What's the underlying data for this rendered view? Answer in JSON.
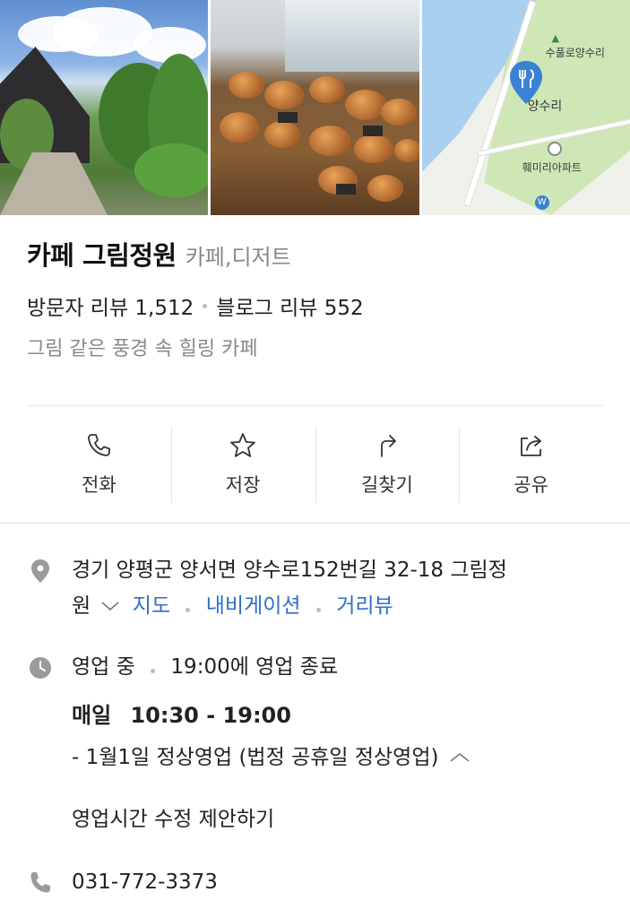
{
  "gallery": {
    "map_labels": {
      "park": "수풀로양수리",
      "station": "양수리",
      "apartment": "훼미리아파트",
      "w_badge": "W"
    }
  },
  "place": {
    "name": "카페 그림정원",
    "category": "카페,디저트",
    "visitor_review_label": "방문자 리뷰 1,512",
    "blog_review_label": "블로그 리뷰 552",
    "tagline": "그림 같은 풍경 속 힐링 카페"
  },
  "actions": [
    {
      "label": "전화",
      "icon": "phone-icon"
    },
    {
      "label": "저장",
      "icon": "star-icon"
    },
    {
      "label": "길찾기",
      "icon": "directions-icon"
    },
    {
      "label": "공유",
      "icon": "share-icon"
    }
  ],
  "address": {
    "line1": "경기 양평군 양서면 양수로152번길 32-18 그림정",
    "line2": "원",
    "map_link": "지도",
    "navigation_link": "내비게이션",
    "street_view_link": "거리뷰"
  },
  "hours": {
    "status": "영업 중",
    "closing": "19:00에 영업 종료",
    "day_label": "매일",
    "time_range": "10:30 - 19:00",
    "note": "- 1월1일 정상영업 (법정 공휴일 정상영업)",
    "suggest_link": "영업시간 수정 제안하기"
  },
  "phone": {
    "number": "031-772-3373"
  },
  "colors": {
    "link": "#2f6fc6",
    "pin": "#3a82d6",
    "muted": "#888888"
  }
}
